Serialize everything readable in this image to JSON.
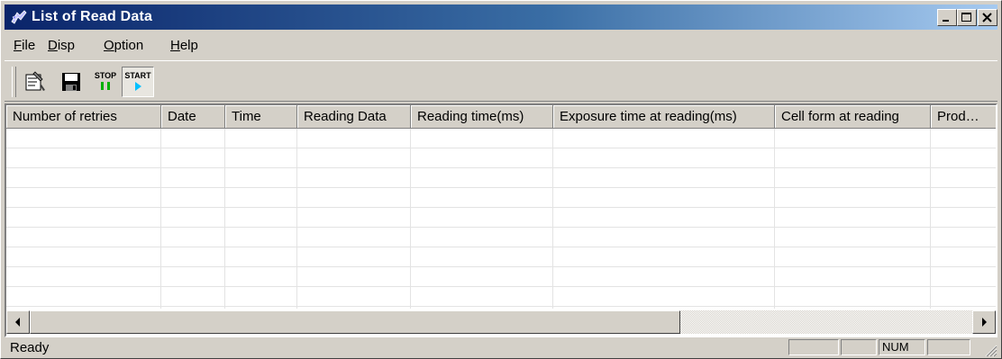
{
  "window": {
    "title": "List of Read Data",
    "icon": "app-icon"
  },
  "menu": [
    {
      "pre": "",
      "acc": "F",
      "post": "ile"
    },
    {
      "pre": "",
      "acc": "D",
      "post": "isp"
    },
    {
      "pre": "",
      "acc": "O",
      "post": "ption"
    },
    {
      "pre": "",
      "acc": "H",
      "post": "elp"
    }
  ],
  "toolbar": {
    "buttons": [
      "properties-icon",
      "save-icon",
      "stop-icon",
      "start-icon"
    ],
    "stop_label": "STOP",
    "start_label": "START"
  },
  "table": {
    "columns": [
      "Number of retries",
      "Date",
      "Time",
      "Reading Data",
      "Reading time(ms)",
      "Exposure time at reading(ms)",
      "Cell form at reading",
      "Prod…"
    ],
    "rows": []
  },
  "status": {
    "text": "Ready",
    "num_indicator": "NUM"
  },
  "colors": {
    "titlebar_start": "#0a246a",
    "titlebar_end": "#a6caf0",
    "face": "#d4d0c8"
  }
}
